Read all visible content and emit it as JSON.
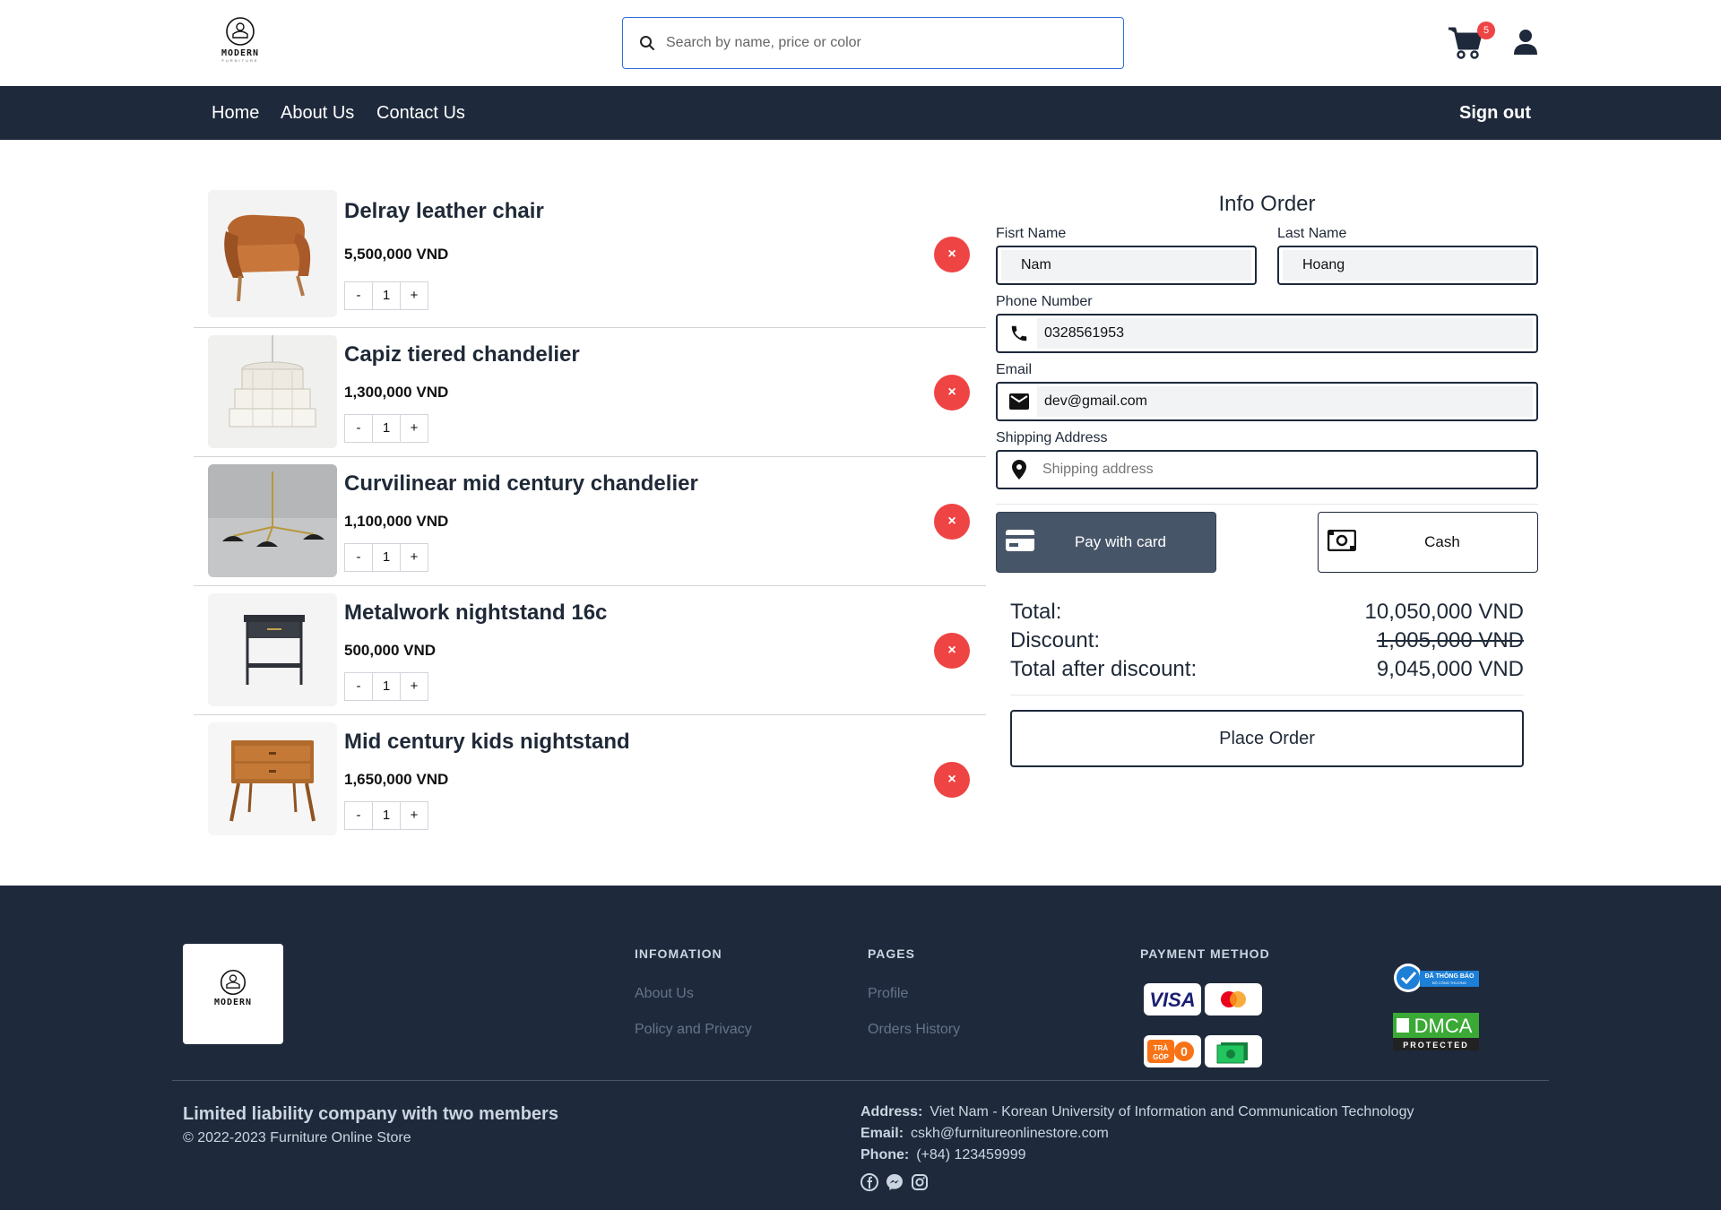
{
  "header": {
    "brand": "MODERN",
    "brand_sub": "FURNITURE",
    "search_placeholder": "Search by name, price or color",
    "cart_count": "5"
  },
  "nav": {
    "links": [
      "Home",
      "About Us",
      "Contact Us"
    ],
    "sign_out": "Sign out"
  },
  "cart": {
    "items": [
      {
        "name": "Delray leather chair",
        "price": "5,500,000 VND",
        "qty": "1"
      },
      {
        "name": "Capiz tiered chandelier",
        "price": "1,300,000 VND",
        "qty": "1"
      },
      {
        "name": "Curvilinear mid century chandelier",
        "price": "1,100,000 VND",
        "qty": "1"
      },
      {
        "name": "Metalwork nightstand 16c",
        "price": "500,000 VND",
        "qty": "1"
      },
      {
        "name": "Mid century kids nightstand",
        "price": "1,650,000 VND",
        "qty": "1"
      }
    ],
    "minus": "-",
    "plus": "+",
    "remove_icon": "×"
  },
  "order": {
    "title": "Info Order",
    "first_name_label": "Fisrt Name",
    "first_name": "Nam",
    "last_name_label": "Last Name",
    "last_name": "Hoang",
    "phone_label": "Phone Number",
    "phone": "0328561953",
    "email_label": "Email",
    "email": "dev@gmail.com",
    "address_label": "Shipping Address",
    "address_placeholder": "Shipping address",
    "pay_card": "Pay with card",
    "pay_cash": "Cash",
    "total_label": "Total:",
    "total": "10,050,000 VND",
    "discount_label": "Discount:",
    "discount": "1,005,000 VND",
    "after_label": "Total after discount:",
    "after": "9,045,000 VND",
    "place_order": "Place Order"
  },
  "footer": {
    "info_heading": "INFOMATION",
    "info_links": [
      "About Us",
      "Policy and Privacy"
    ],
    "pages_heading": "PAGES",
    "pages_links": [
      "Profile",
      "Orders History"
    ],
    "payment_heading": "PAYMENT METHOD",
    "payment_methods": [
      "VISA",
      "Mastercard",
      "TRẢ GÓP 0",
      "Cash"
    ],
    "company": "Limited liability company with two members",
    "copyright": "© 2022-2023 Furniture Online Store",
    "address_label": "Address:",
    "address": "Viet Nam - Korean University of Information and Communication Technology",
    "email_label": "Email:",
    "email": "cskh@furnitureonlinestore.com",
    "phone_label": "Phone:",
    "phone": "(+84) 123459999",
    "badge_notice": "ĐÃ THÔNG BÁO",
    "badge_notice_sub": "BỘ CÔNG THƯƠNG",
    "badge_dmca": "DMCA",
    "badge_dmca_sub": "PROTECTED",
    "colors": {
      "footer_bg": "#1e293b",
      "accent_red": "#ef4444"
    }
  }
}
